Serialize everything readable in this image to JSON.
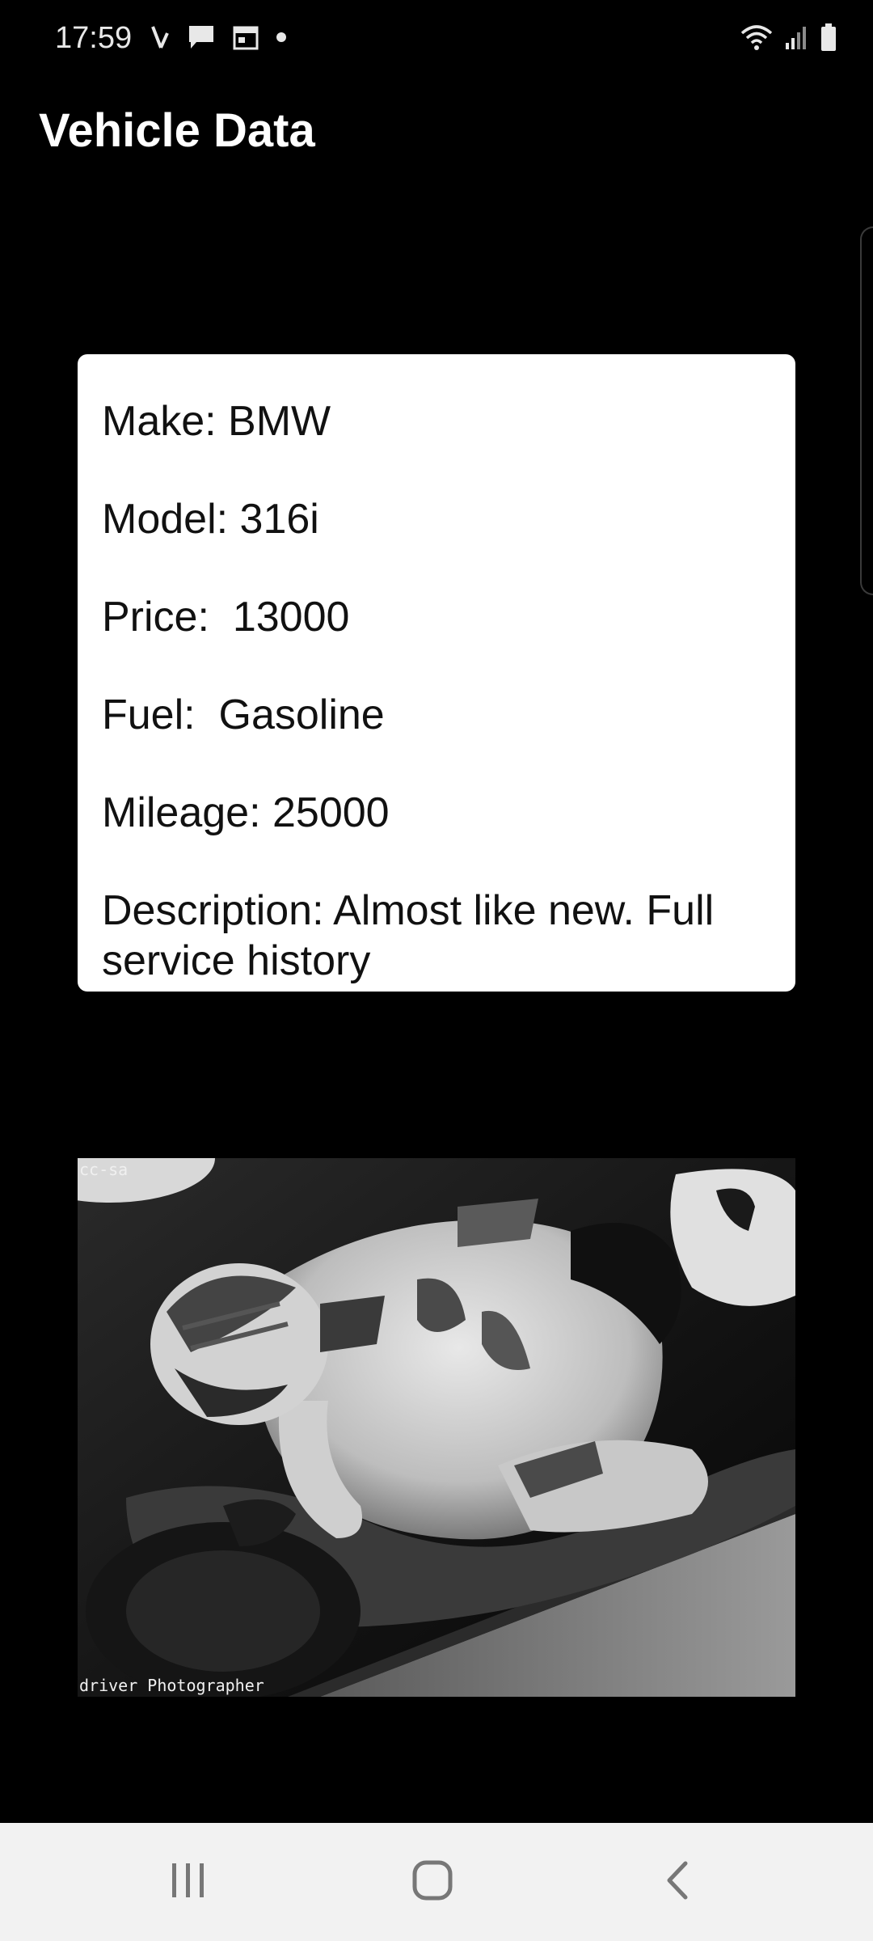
{
  "status_bar": {
    "time": "17:59",
    "left_icons": [
      "missed-call-icon",
      "chat-bubble-icon",
      "calendar-icon",
      "dot-icon"
    ],
    "right_icons": [
      "wifi-icon",
      "signal-icon",
      "battery-icon"
    ]
  },
  "app_bar": {
    "title": "Vehicle Data"
  },
  "vehicle": {
    "make": "Make: BMW",
    "model": "Model: 316i",
    "price": "Price:  13000",
    "fuel": "Fuel:  Gasoline",
    "mileage": "Mileage: 25000",
    "description": "Description: Almost like new. Full service history"
  },
  "photo": {
    "license": "cc-sa",
    "credit": "driver Photographer"
  },
  "nav_bar": {
    "icons": [
      "recent-apps-icon",
      "home-icon",
      "back-icon"
    ]
  },
  "colors": {
    "background": "#000000",
    "card": "#ffffff",
    "nav_bar": "#f2f2f2"
  }
}
